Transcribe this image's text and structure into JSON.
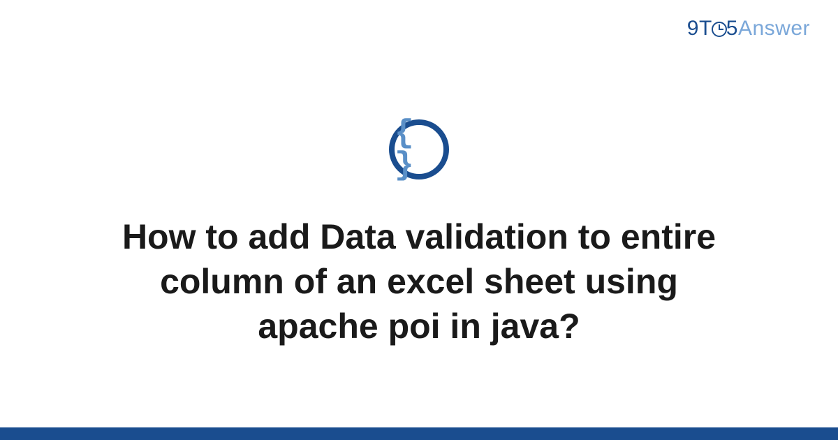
{
  "logo": {
    "part1": "9",
    "part2": "T",
    "part3": "5",
    "part4": "Answer"
  },
  "icon": {
    "name": "code-braces-icon",
    "glyph": "{ }"
  },
  "title": "How to add Data validation to entire column of an excel sheet using apache poi in java?",
  "colors": {
    "primary": "#1a4d8f",
    "secondary": "#7aa7d9",
    "text": "#1a1a1a"
  }
}
